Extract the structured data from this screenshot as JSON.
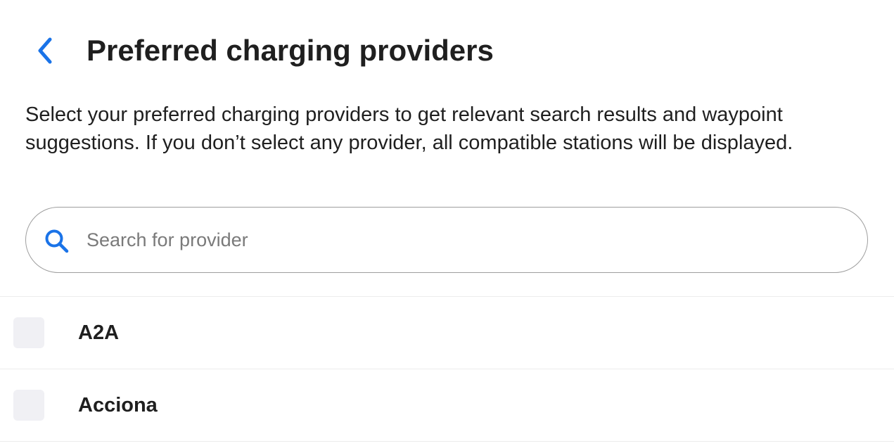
{
  "header": {
    "back_icon": "chevron-left-icon",
    "title": "Preferred charging providers"
  },
  "description": "Select your preferred charging providers to get relevant search results and waypoint suggestions. If you don’t select any provider, all compatible stations will be displayed.",
  "search": {
    "icon": "search-icon",
    "placeholder": "Search for provider",
    "value": ""
  },
  "providers": [
    {
      "label": "A2A",
      "checked": false
    },
    {
      "label": "Acciona",
      "checked": false
    }
  ],
  "colors": {
    "accent": "#1a73e8",
    "text": "#1f1f1f",
    "placeholder": "#7a7a7a",
    "checkbox_bg": "#f0f0f4",
    "divider": "#ececec",
    "search_border": "#9e9e9e"
  }
}
